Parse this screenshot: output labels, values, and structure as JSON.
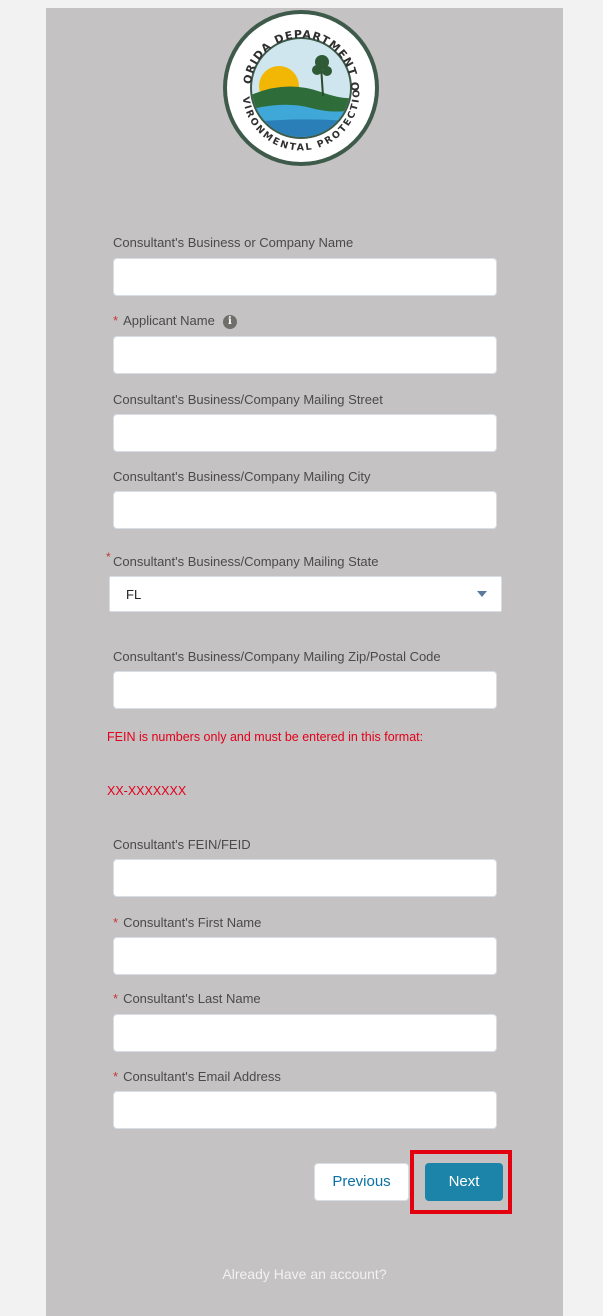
{
  "logo": {
    "top_text": "FLORIDA DEPARTMENT OF",
    "bottom_text": "ENVIRONMENTAL PROTECTION"
  },
  "form": {
    "company_name": {
      "label": "Consultant's Business or Company Name",
      "value": ""
    },
    "applicant_name": {
      "label": "Applicant Name",
      "required_mark": "*",
      "value": ""
    },
    "mailing_street": {
      "label": "Consultant's Business/Company Mailing Street",
      "value": ""
    },
    "mailing_city": {
      "label": "Consultant's Business/Company Mailing City",
      "value": ""
    },
    "mailing_state": {
      "label": "Consultant's Business/Company Mailing State",
      "required_mark": "*",
      "selected": "FL"
    },
    "mailing_zip": {
      "label": "Consultant's Business/Company Mailing Zip/Postal Code",
      "value": ""
    },
    "fein_note": "FEIN is numbers only and must be entered in this format:",
    "fein_format": "XX-XXXXXXX",
    "fein": {
      "label": "Consultant's FEIN/FEID",
      "value": ""
    },
    "first_name": {
      "label": "Consultant's First Name",
      "required_mark": "*",
      "value": ""
    },
    "last_name": {
      "label": "Consultant's Last Name",
      "required_mark": "*",
      "value": ""
    },
    "email": {
      "label": "Consultant's Email Address",
      "required_mark": "*",
      "value": ""
    }
  },
  "buttons": {
    "previous": "Previous",
    "next": "Next"
  },
  "footer": {
    "already_account": "Already Have an account?"
  },
  "colors": {
    "panel": "#c4c2c2",
    "required": "#c23934",
    "warning": "#e3001b",
    "next_button": "#1b84a8",
    "highlight": "#e3000f"
  }
}
